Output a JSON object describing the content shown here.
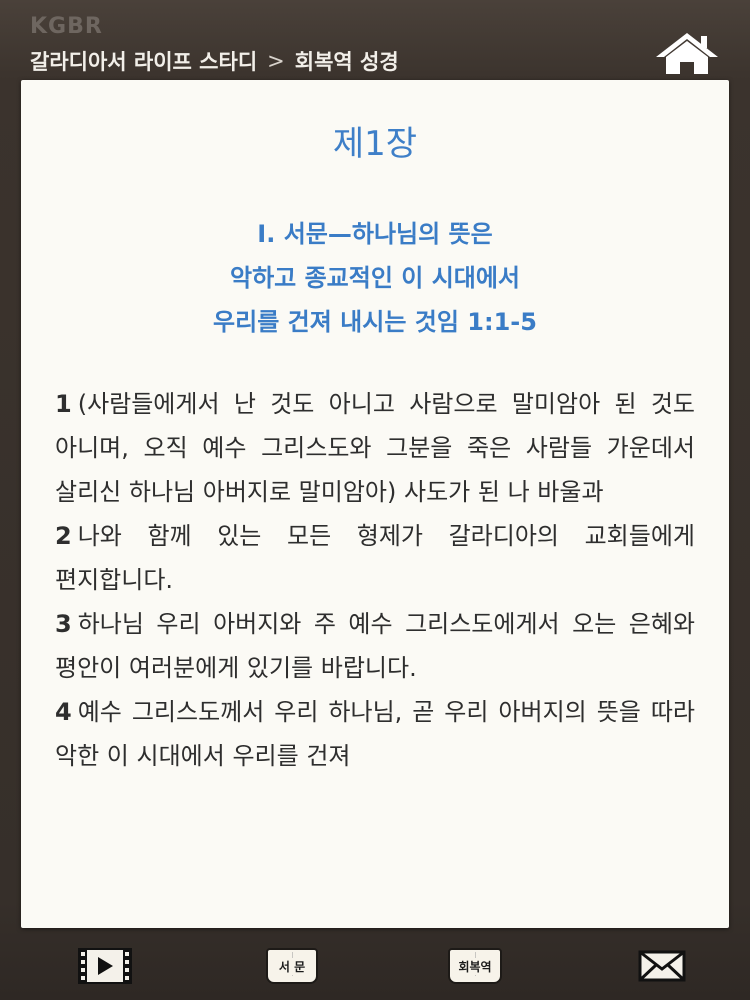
{
  "header": {
    "brand": "KGBR",
    "breadcrumb": {
      "parent": "갈라디아서 라이프 스타디",
      "separator": ">",
      "current": "회복역 성경"
    },
    "home_icon": "home-icon"
  },
  "content": {
    "chapter_title": "제1장",
    "section_heading_lines": [
      "Ⅰ. 서문—하나님의 뜻은",
      "악하고 종교적인 이 시대에서",
      "우리를 건져 내시는 것임 1:1-5"
    ],
    "verses": [
      {
        "num": "1",
        "text": "(사람들에게서 난 것도 아니고 사람으로 말미암아 된 것도 아니며, 오직 예수 그리스도와 그분을 죽은 사람들 가운데서 살리신 하나님 아버지로 말미암아) 사도가 된 나 바울과"
      },
      {
        "num": "2",
        "text": "나와 함께 있는 모든 형제가 갈라디아의 교회들에게 편지합니다."
      },
      {
        "num": "3",
        "text": "하나님 우리 아버지와 주 예수 그리스도에게서 오는 은혜와 평안이 여러분에게 있기를 바랍니다."
      },
      {
        "num": "4",
        "text": "예수 그리스도께서 우리 하나님, 곧 우리 아버지의 뜻을 따라 악한 이 시대에서 우리를 건져"
      }
    ]
  },
  "toolbar": {
    "video_icon": "video-play-icon",
    "intro_label": "서 문",
    "recovery_label": "회복역",
    "mail_icon": "mail-icon"
  },
  "colors": {
    "frame": "#3a322c",
    "page": "#fbfaf5",
    "accent_blue": "#3e7fc8",
    "text": "#2e2e2e"
  }
}
